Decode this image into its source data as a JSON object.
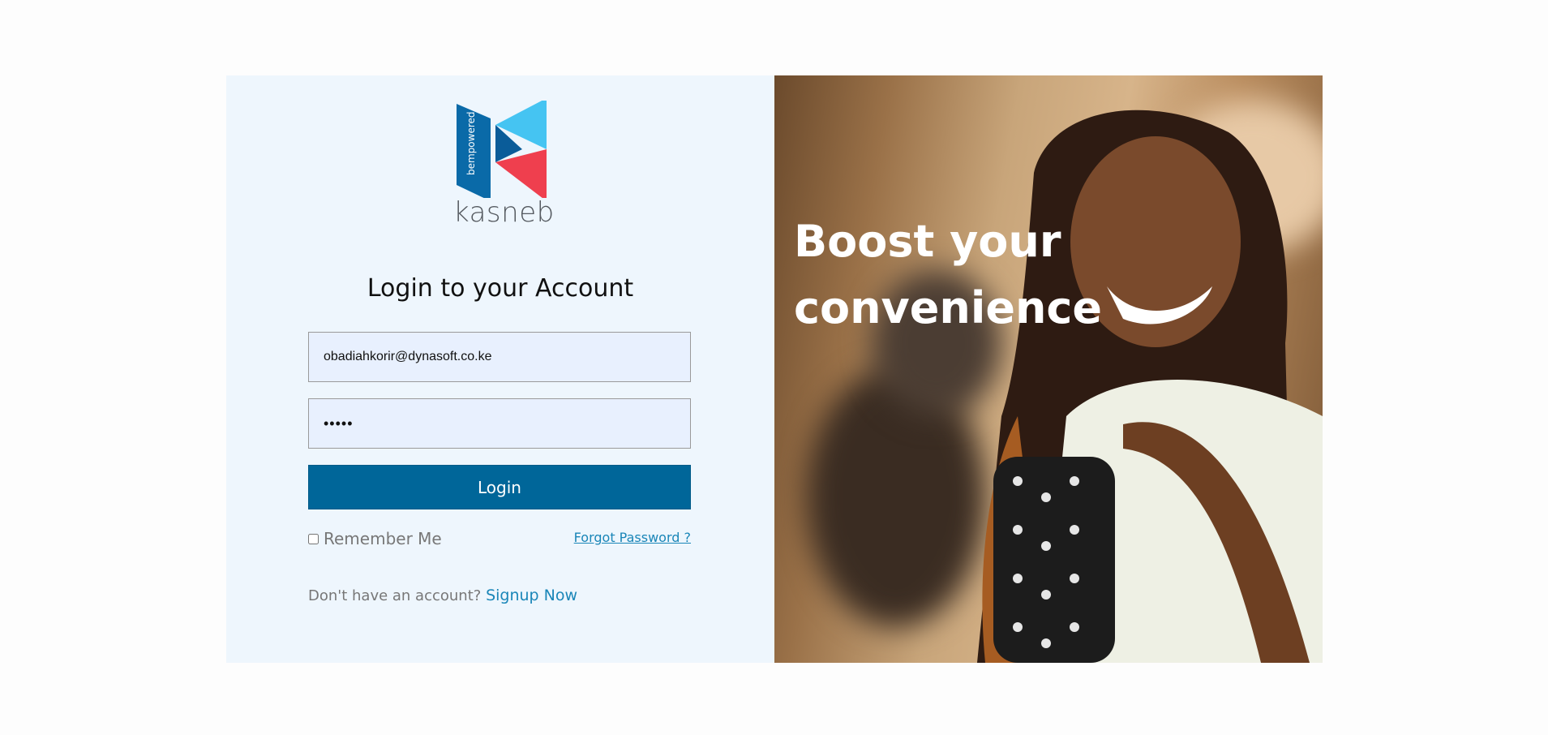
{
  "brand": {
    "logo_name": "kasneb",
    "logo_tagline": "bempowered",
    "colors": {
      "dark_blue": "#0a6aa8",
      "light_blue": "#45c4f2",
      "red": "#ef3f4e"
    }
  },
  "login": {
    "title": "Login to your Account",
    "email_value": "obadiahkorir@dynasoft.co.ke",
    "password_value": "•••••",
    "login_label": "Login",
    "remember_label": "Remember Me",
    "forgot_label": "Forgot Password ?",
    "signup_prompt": "Don't have an account?",
    "signup_label": "Signup Now"
  },
  "hero": {
    "headline": "Boost your convenience"
  },
  "colors": {
    "left_bg": "#eef6fd",
    "button_bg": "#006699",
    "link": "#1a86b8",
    "field_bg": "#e8f0fe"
  }
}
